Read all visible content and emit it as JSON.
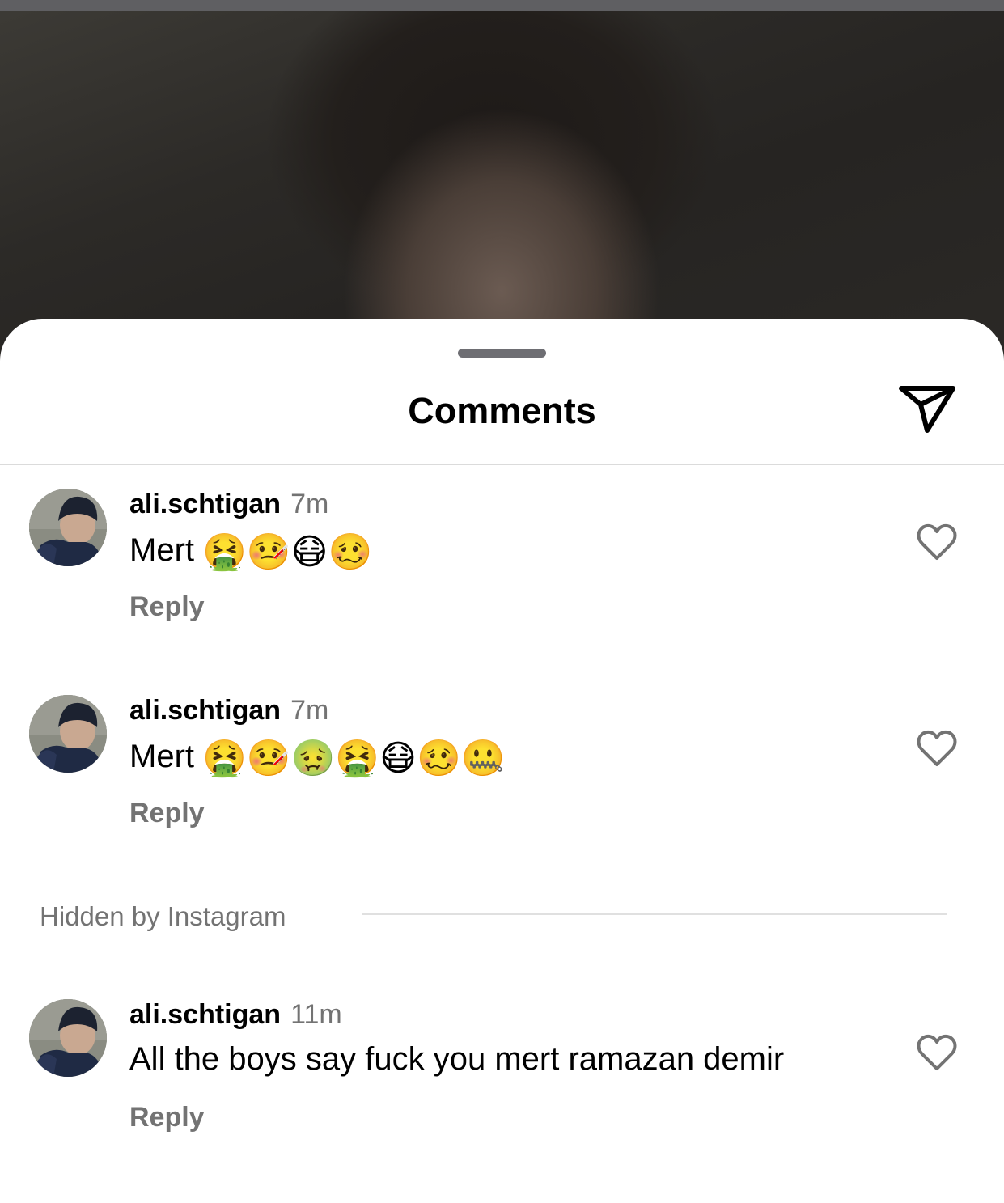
{
  "sheet": {
    "title": "Comments",
    "share_icon": "paper-plane-icon"
  },
  "comments": [
    {
      "username": "ali.schtigan",
      "time": "7m",
      "text": "Mert",
      "emojis": "🤮🤒😷🥴",
      "reply_label": "Reply",
      "like_icon": "heart-outline-icon"
    },
    {
      "username": "ali.schtigan",
      "time": "7m",
      "text": "Mert",
      "emojis": "🤮🤒🤢🤮😷🥴🤐",
      "reply_label": "Reply",
      "like_icon": "heart-outline-icon"
    },
    {
      "username": "ali.schtigan",
      "time": "11m",
      "text": "All the boys say fuck you mert ramazan demir",
      "emojis": "",
      "reply_label": "Reply",
      "like_icon": "heart-outline-icon"
    }
  ],
  "hidden_section": {
    "label": "Hidden by Instagram"
  },
  "colors": {
    "secondary_text": "#737373",
    "sheet_background": "#ffffff",
    "divider": "#dbdbdb"
  }
}
